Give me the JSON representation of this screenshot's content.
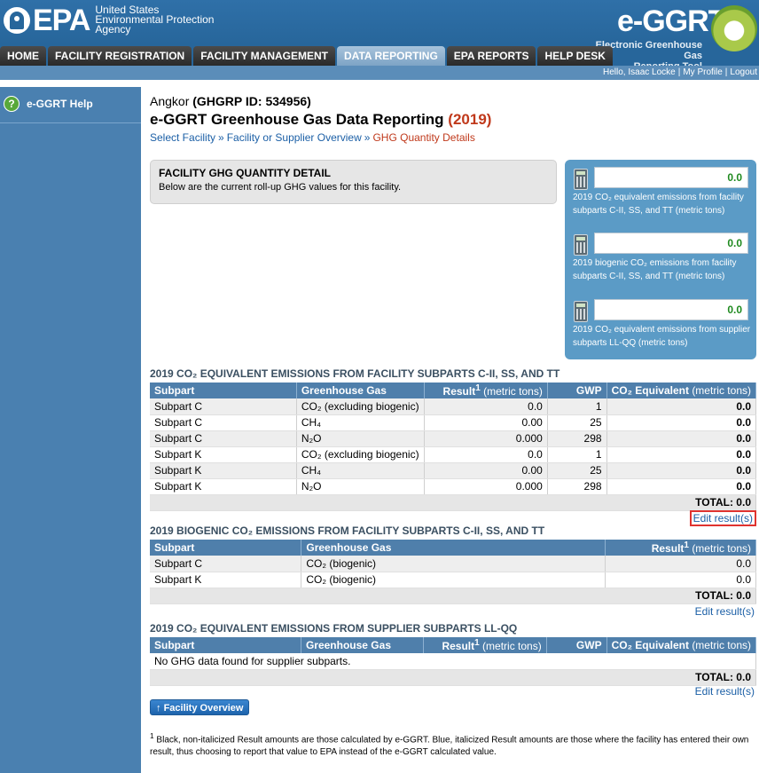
{
  "header": {
    "epa_word": "EPA",
    "agency_lines": [
      "United States",
      "Environmental Protection",
      "Agency"
    ],
    "app_logo": "e-GGRT",
    "app_subtitle_lines": [
      "Electronic Greenhouse Gas",
      "Reporting Tool"
    ]
  },
  "nav": {
    "tabs": [
      {
        "label": "HOME"
      },
      {
        "label": "FACILITY REGISTRATION"
      },
      {
        "label": "FACILITY MANAGEMENT"
      },
      {
        "label": "DATA REPORTING"
      },
      {
        "label": "EPA REPORTS"
      },
      {
        "label": "HELP DESK"
      }
    ],
    "active_index": 3,
    "user_greeting": "Hello, Isaac Locke",
    "my_profile": "My Profile",
    "logout": "Logout"
  },
  "sidebar": {
    "help_label": "e-GGRT Help",
    "help_icon": "?"
  },
  "page": {
    "facility_name": "Angkor",
    "facility_id_text": "(GHGRP ID: 534956)",
    "title": "e-GGRT Greenhouse Gas Data Reporting",
    "year_text": "(2019)",
    "breadcrumb": [
      {
        "label": "Select Facility"
      },
      {
        "label": "Facility or Supplier Overview"
      },
      {
        "label": "GHG Quantity Details"
      }
    ],
    "breadcrumb_sep": "»"
  },
  "detail_box": {
    "title": "FACILITY GHG QUANTITY DETAIL",
    "text": "Below are the current roll-up GHG values for this facility."
  },
  "summary": [
    {
      "value": "0.0",
      "label": "2019 CO₂ equivalent emissions from facility subparts C-II, SS, and TT (metric tons)"
    },
    {
      "value": "0.0",
      "label": "2019 biogenic CO₂ emissions from facility subparts C-II, SS, and TT (metric tons)"
    },
    {
      "value": "0.0",
      "label": "2019 CO₂ equivalent emissions from supplier subparts LL-QQ (metric tons)"
    }
  ],
  "section1": {
    "title": "2019 CO₂ EQUIVALENT EMISSIONS FROM FACILITY SUBPARTS C-II, SS, AND TT",
    "headers": {
      "subpart": "Subpart",
      "gas": "Greenhouse Gas",
      "result": "Result",
      "result_sup": "1",
      "result_unit": "(metric tons)",
      "gwp": "GWP",
      "co2e": "CO₂ Equivalent",
      "co2e_unit": "(metric tons)"
    },
    "rows": [
      {
        "subpart": "Subpart C",
        "gas": "CO₂ (excluding biogenic)",
        "result": "0.0",
        "gwp": "1",
        "co2e": "0.0"
      },
      {
        "subpart": "Subpart C",
        "gas": "CH₄",
        "result": "0.00",
        "gwp": "25",
        "co2e": "0.0"
      },
      {
        "subpart": "Subpart C",
        "gas": "N₂O",
        "result": "0.000",
        "gwp": "298",
        "co2e": "0.0"
      },
      {
        "subpart": "Subpart K",
        "gas": "CO₂ (excluding biogenic)",
        "result": "0.0",
        "gwp": "1",
        "co2e": "0.0"
      },
      {
        "subpart": "Subpart K",
        "gas": "CH₄",
        "result": "0.00",
        "gwp": "25",
        "co2e": "0.0"
      },
      {
        "subpart": "Subpart K",
        "gas": "N₂O",
        "result": "0.000",
        "gwp": "298",
        "co2e": "0.0"
      }
    ],
    "total": "TOTAL: 0.0",
    "edit_link": "Edit result(s)"
  },
  "section2": {
    "title": "2019 BIOGENIC CO₂ EMISSIONS FROM FACILITY SUBPARTS C-II, SS, AND TT",
    "headers": {
      "subpart": "Subpart",
      "gas": "Greenhouse Gas",
      "result": "Result",
      "result_sup": "1",
      "result_unit": "(metric tons)"
    },
    "rows": [
      {
        "subpart": "Subpart C",
        "gas": "CO₂ (biogenic)",
        "result": "0.0"
      },
      {
        "subpart": "Subpart K",
        "gas": "CO₂ (biogenic)",
        "result": "0.0"
      }
    ],
    "total": "TOTAL: 0.0",
    "edit_link": "Edit result(s)"
  },
  "section3": {
    "title": "2019 CO₂ EQUIVALENT EMISSIONS FROM SUPPLIER SUBPARTS LL-QQ",
    "headers": {
      "subpart": "Subpart",
      "gas": "Greenhouse Gas",
      "result": "Result",
      "result_sup": "1",
      "result_unit": "(metric tons)",
      "gwp": "GWP",
      "co2e": "CO₂ Equivalent",
      "co2e_unit": "(metric tons)"
    },
    "empty_text": "No GHG data found for supplier subparts.",
    "total": "TOTAL: 0.0",
    "edit_link": "Edit result(s)"
  },
  "overview_button": {
    "arrow": "↑",
    "label": "Facility Overview"
  },
  "footnote": {
    "marker": "1",
    "text": "Black, non-italicized Result amounts are those calculated by e-GGRT. Blue, italicized Result amounts are those where the facility has entered their own result, thus choosing to report that value to EPA instead of the e-GGRT calculated value."
  },
  "colors": {
    "header_blue": "#27669b",
    "sidebar_blue": "#4a80b0",
    "table_header": "#4f7fab",
    "accent_red": "#c0391b",
    "link_blue": "#1b5fa6",
    "value_green": "#1f8a1f",
    "highlight_red": "#e0332f"
  }
}
